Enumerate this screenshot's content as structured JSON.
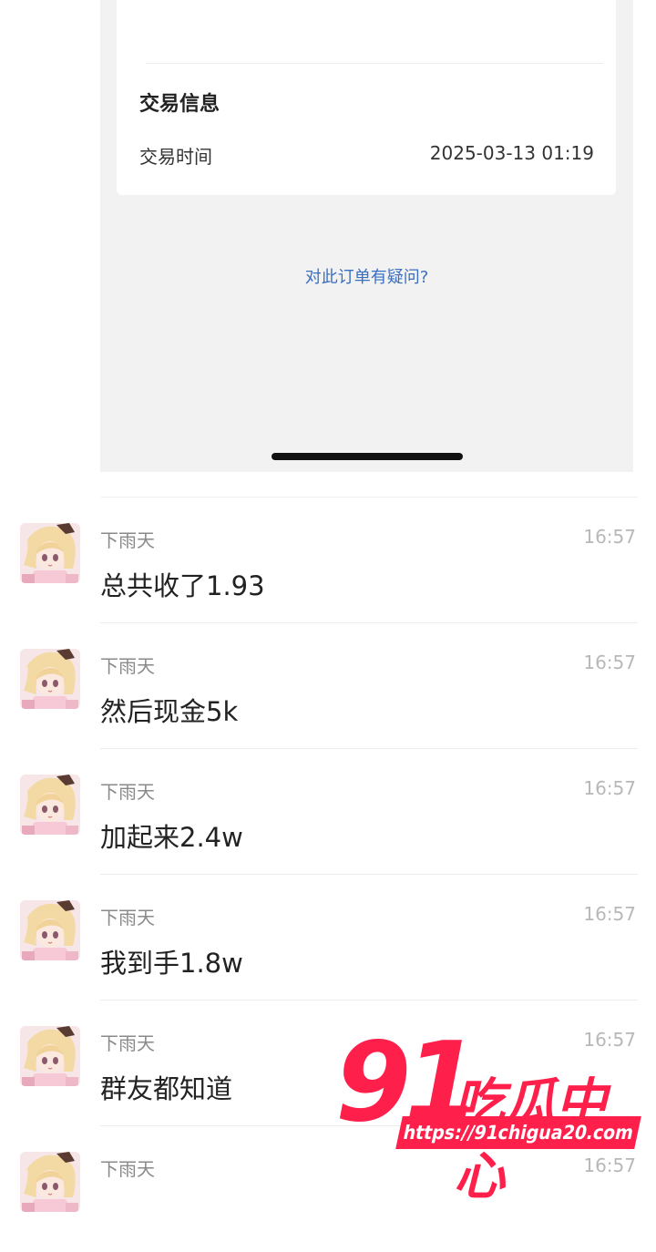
{
  "order_panel": {
    "section_title": "交易信息",
    "time_label": "交易时间",
    "time_value": "2025-03-13 01:19",
    "question_link": "对此订单有疑问?"
  },
  "messages": [
    {
      "sender": "下雨天",
      "time": "16:57",
      "text": "总共收了1.93"
    },
    {
      "sender": "下雨天",
      "time": "16:57",
      "text": "然后现金5k"
    },
    {
      "sender": "下雨天",
      "time": "16:57",
      "text": "加起来2.4w"
    },
    {
      "sender": "下雨天",
      "time": "16:57",
      "text": "我到手1.8w"
    },
    {
      "sender": "下雨天",
      "time": "16:57",
      "text": "群友都知道"
    },
    {
      "sender": "下雨天",
      "time": "16:57",
      "text": ""
    }
  ],
  "watermark": {
    "number": "91",
    "chinese": "吃瓜中心",
    "url": "https://91chigua20.com"
  },
  "colors": {
    "link": "#3a6fc1",
    "watermark": "#ff1f4b"
  }
}
